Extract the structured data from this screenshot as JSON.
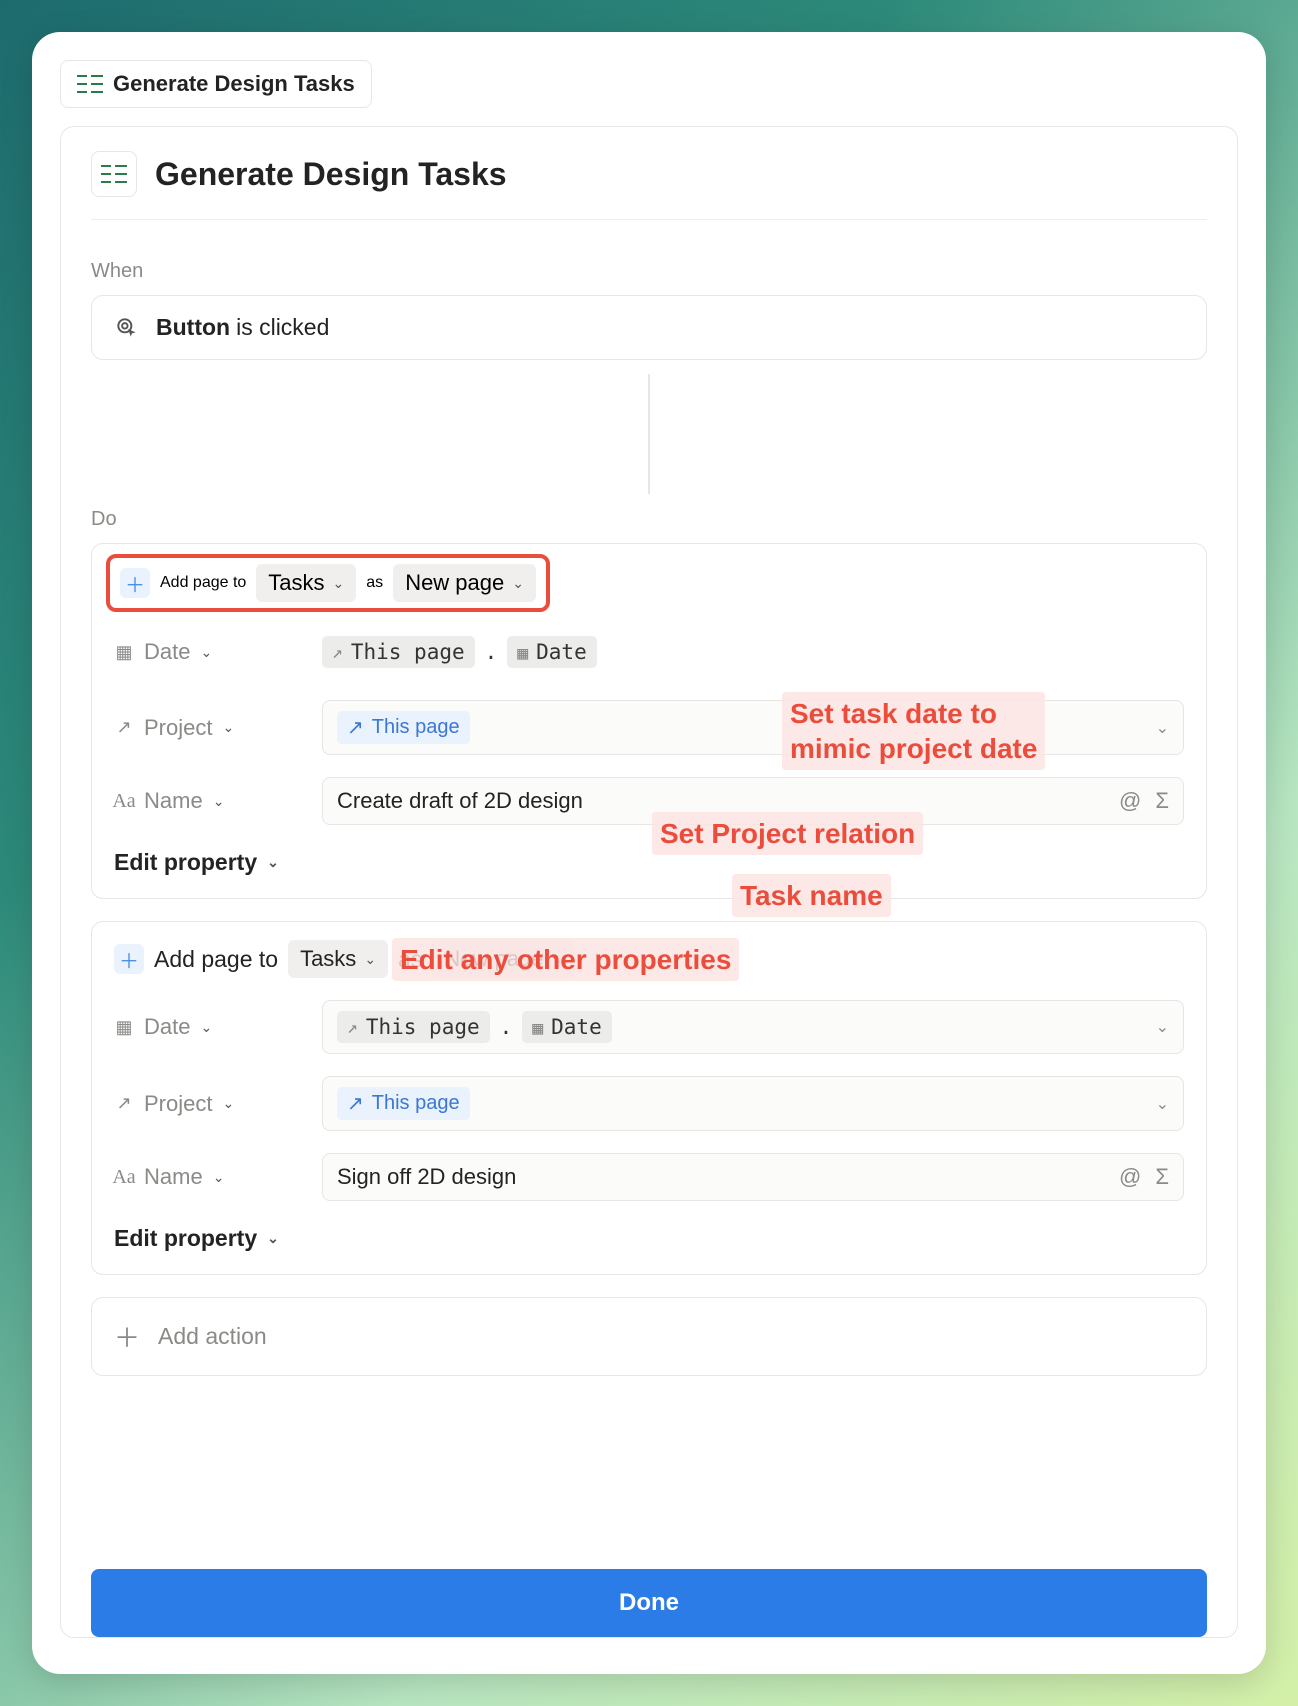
{
  "pill_label": "Generate Design Tasks",
  "title": "Generate Design Tasks",
  "section_when": "When",
  "section_do": "Do",
  "trigger": {
    "bold": "Button",
    "rest": "is clicked"
  },
  "action_template": {
    "prefix": "Add page to",
    "db": "Tasks",
    "as": "as",
    "mode": "New page"
  },
  "props": {
    "date_label": "Date",
    "project_label": "Project",
    "name_label": "Name",
    "token_this_page": "This page",
    "token_date": "Date"
  },
  "actions": [
    {
      "name_value": "Create draft of 2D design"
    },
    {
      "name_value": "Sign off 2D design"
    }
  ],
  "edit_property": "Edit property",
  "add_action": "Add action",
  "done": "Done",
  "annotations": {
    "a1": "Set task date to\nmimic project date",
    "a2": "Set Project relation",
    "a3": "Task name",
    "a4": "Edit any other properties"
  }
}
